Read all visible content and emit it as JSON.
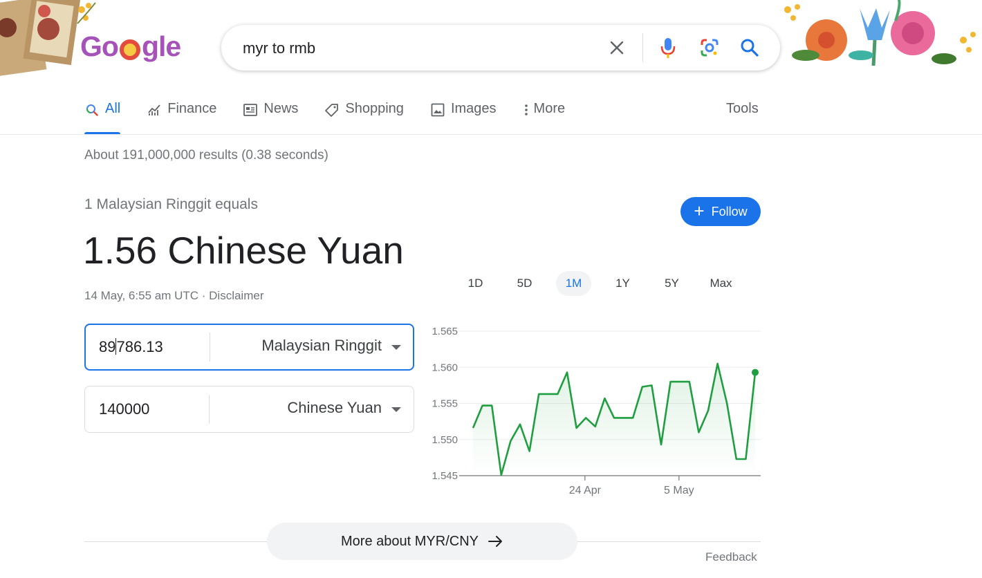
{
  "search": {
    "query": "myr to rmb"
  },
  "tabs": [
    {
      "label": "All"
    },
    {
      "label": "Finance"
    },
    {
      "label": "News"
    },
    {
      "label": "Shopping"
    },
    {
      "label": "Images"
    },
    {
      "label": "More"
    }
  ],
  "tools_label": "Tools",
  "results_count": "About 191,000,000 results (0.38 seconds)",
  "converter": {
    "equals_label": "1 Malaysian Ringgit equals",
    "result": "1.56 Chinese Yuan",
    "timestamp": "14 May, 6:55 am UTC · ",
    "disclaimer": "Disclaimer",
    "follow_label": "Follow",
    "from": {
      "amount_before_cursor": "89",
      "amount_after_cursor": "786.13",
      "currency": "Malaysian Ringgit"
    },
    "to": {
      "amount": "140000",
      "currency": "Chinese Yuan"
    },
    "ranges": [
      "1D",
      "5D",
      "1M",
      "1Y",
      "5Y",
      "Max"
    ],
    "active_range": "1M"
  },
  "chart_data": {
    "type": "line",
    "title": "",
    "xlabel": "",
    "ylabel": "",
    "ylim": [
      1.545,
      1.565
    ],
    "y_ticks": [
      "1.565",
      "1.560",
      "1.555",
      "1.550",
      "1.545"
    ],
    "x_ticks": [
      "24 Apr",
      "5 May"
    ],
    "x_tick_index": [
      11.9,
      21.9
    ],
    "grid": true,
    "color": "#1e9e3e",
    "values": [
      1.5516,
      1.5547,
      1.5547,
      1.5451,
      1.5498,
      1.5521,
      1.5484,
      1.5563,
      1.5563,
      1.5563,
      1.5593,
      1.5516,
      1.553,
      1.5518,
      1.5557,
      1.553,
      1.553,
      1.553,
      1.5573,
      1.5575,
      1.5493,
      1.558,
      1.558,
      1.558,
      1.551,
      1.554,
      1.5605,
      1.555,
      1.5473,
      1.5473,
      1.5593
    ]
  },
  "more_about_label": "More about MYR/CNY",
  "feedback_label": "Feedback",
  "colors": {
    "accent": "#1a73e8",
    "chart_line": "#1e9e3e"
  }
}
